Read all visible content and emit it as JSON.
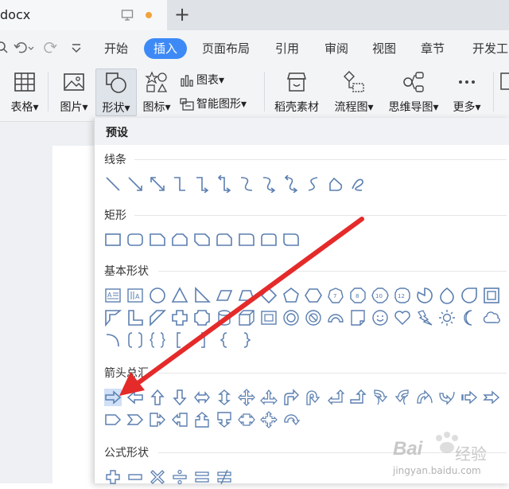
{
  "tabbar": {
    "doc_title": "docx",
    "new_tab": "+"
  },
  "menu": {
    "items": [
      "开始",
      "插入",
      "页面布局",
      "引用",
      "审阅",
      "视图",
      "章节",
      "开发工"
    ],
    "active_index": 1
  },
  "ribbon": {
    "table": "表格",
    "picture": "图片",
    "shape": "形状",
    "icon": "图标",
    "chart": "图表",
    "smart_graphic": "智能图形",
    "material": "稻壳素材",
    "flowchart": "流程图",
    "mindmap": "思维导图",
    "more": "更多",
    "dropdown_arrow": "▾"
  },
  "panel": {
    "header": "预设",
    "sections": {
      "lines": "线条",
      "rect": "矩形",
      "basic": "基本形状",
      "arrows": "箭头总汇",
      "formula": "公式形状"
    }
  },
  "watermark": {
    "brand": "Bai",
    "brand2": "经验",
    "url": "jingyan.baidu.com"
  },
  "colors": {
    "accent": "#3d8af7",
    "shape_stroke": "#5b7fb0",
    "annotation": "#e52a2a"
  }
}
